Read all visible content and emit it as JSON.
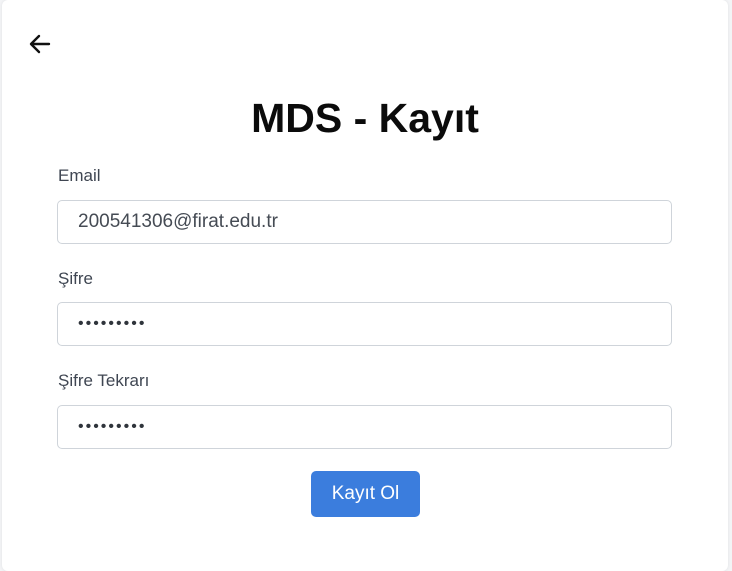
{
  "form": {
    "title": "MDS - Kayıt",
    "email_label": "Email",
    "email_value": "200541306@firat.edu.tr",
    "password_label": "Şifre",
    "password_value": "•••••••••",
    "password_confirm_label": "Şifre Tekrarı",
    "password_confirm_value": "•••••••••",
    "submit_label": "Kayıt Ol"
  },
  "icons": {
    "back": "arrow-left-icon"
  },
  "colors": {
    "primary_button": "#3b7ddd",
    "title_text": "#0b0b0b",
    "label_text": "#3f4652",
    "input_border": "#cfd4da"
  }
}
